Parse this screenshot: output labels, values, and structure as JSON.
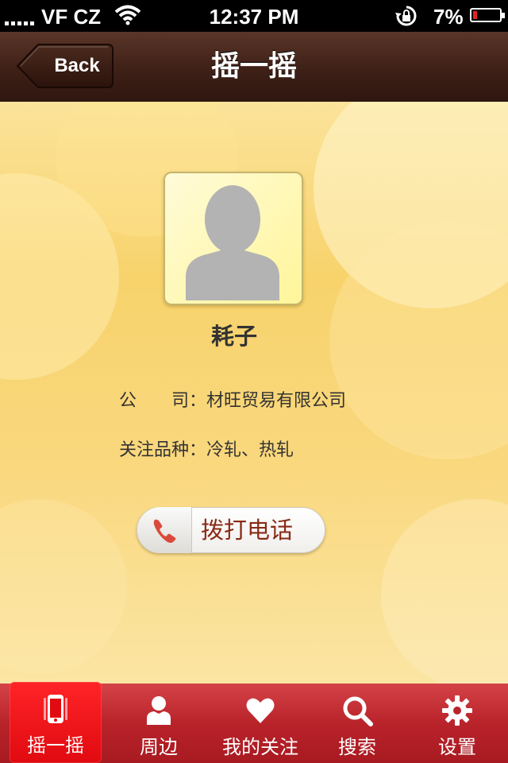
{
  "status_bar": {
    "carrier": "VF CZ",
    "time": "12:37 PM",
    "battery_percent": "7%"
  },
  "nav": {
    "back_label": "Back",
    "title": "摇一摇"
  },
  "profile": {
    "name": "耗子",
    "company_label": "公　　司：",
    "company_value": "材旺贸易有限公司",
    "interest_label": "关注品种：",
    "interest_value": "冷轧、热轧"
  },
  "actions": {
    "call_label": "拨打电话"
  },
  "tabs": [
    {
      "label": "摇一摇",
      "icon": "phone-shake-icon",
      "selected": true
    },
    {
      "label": "周边",
      "icon": "person-icon",
      "selected": false
    },
    {
      "label": "我的关注",
      "icon": "heart-icon",
      "selected": false
    },
    {
      "label": "搜索",
      "icon": "search-icon",
      "selected": false
    },
    {
      "label": "设置",
      "icon": "gear-icon",
      "selected": false
    }
  ],
  "colors": {
    "nav_background": "#3e2017",
    "tab_background": "#b9232a",
    "tab_selected": "#e00a10",
    "call_text": "#8a2a16",
    "battery_low": "#e4222c"
  }
}
